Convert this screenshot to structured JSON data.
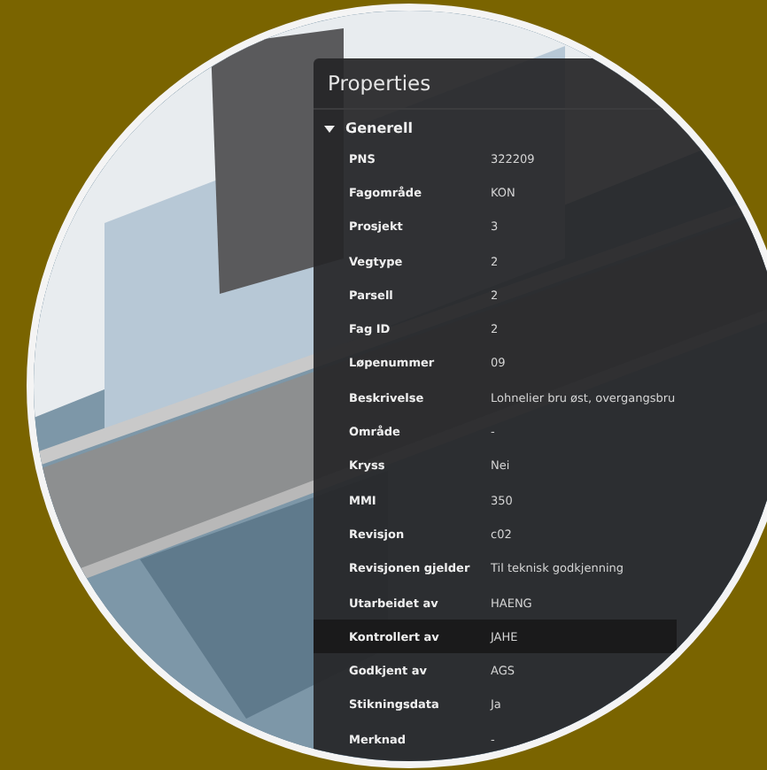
{
  "panel": {
    "title": "Properties"
  },
  "section": {
    "title": "Generell",
    "expanded": true,
    "rows": [
      {
        "label": "PNS",
        "value": "322209",
        "selected": false
      },
      {
        "label": "Fagområde",
        "value": "KON",
        "selected": false
      },
      {
        "label": "Prosjekt",
        "value": "3",
        "selected": false
      },
      {
        "label": "Vegtype",
        "value": "2",
        "selected": false
      },
      {
        "label": "Parsell",
        "value": "2",
        "selected": false
      },
      {
        "label": "Fag ID",
        "value": "2",
        "selected": false
      },
      {
        "label": "Løpenummer",
        "value": "09",
        "selected": false
      },
      {
        "label": "Beskrivelse",
        "value": "Lohnelier bru øst, overgangsbru",
        "selected": false
      },
      {
        "label": "Område",
        "value": "-",
        "selected": false
      },
      {
        "label": "Kryss",
        "value": "Nei",
        "selected": false
      },
      {
        "label": "MMI",
        "value": "350",
        "selected": false
      },
      {
        "label": "Revisjon",
        "value": "c02",
        "selected": false
      },
      {
        "label": "Revisjonen gjelder",
        "value": "Til teknisk godkjenning",
        "selected": false
      },
      {
        "label": "Utarbeidet av",
        "value": "HAENG",
        "selected": false
      },
      {
        "label": "Kontrollert av",
        "value": "JAHE",
        "selected": true
      },
      {
        "label": "Godkjent av",
        "value": "AGS",
        "selected": false
      },
      {
        "label": "Stikningsdata",
        "value": "Ja",
        "selected": false
      },
      {
        "label": "Merknad",
        "value": "-",
        "selected": false
      }
    ]
  }
}
